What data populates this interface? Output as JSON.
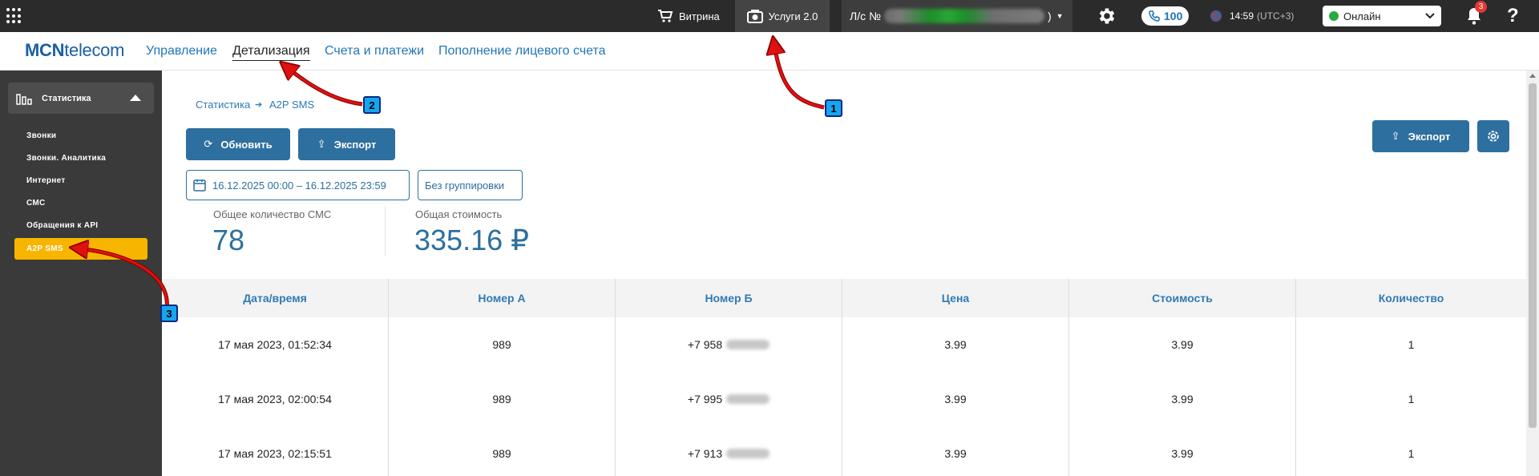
{
  "topbar": {
    "apps_icon": "grid-apps-icon",
    "showcase_label": "Витрина",
    "services_label": "Услуги 2.0",
    "account_prefix": "Л/с №",
    "account_suffix": ")",
    "phone_count": "100",
    "time": "14:59",
    "timezone": "(UTC+3)",
    "status": "Онлайн",
    "notifications_count": "3",
    "help": "?"
  },
  "nav": {
    "logo_bold": "MCN",
    "logo_rest": "telecom",
    "links": [
      "Управление",
      "Детализация",
      "Счета и платежи",
      "Пополнение лицевого счета"
    ],
    "active": "Детализация"
  },
  "sidebar": {
    "section": "Статистика",
    "items": [
      "Звонки",
      "Звонки. Аналитика",
      "Интернет",
      "СМС",
      "Обращения к API",
      "A2P SMS"
    ],
    "active": "A2P SMS"
  },
  "breadcrumb": [
    "Статистика",
    "A2P SMS"
  ],
  "toolbar": {
    "refresh": "Обновить",
    "export": "Экспорт",
    "export_right": "Экспорт",
    "date_range": "16.12.2025 00:00 – 16.12.2025 23:59",
    "grouping": "Без группировки"
  },
  "stats": {
    "count_label": "Общее количество СМС",
    "count_value": "78",
    "cost_label": "Общая стоимость",
    "cost_value": "335.16 ₽"
  },
  "table": {
    "columns": [
      "Дата/время",
      "Номер А",
      "Номер Б",
      "Цена",
      "Стоимость",
      "Количество"
    ],
    "rows": [
      [
        "17 мая 2023, 01:52:34",
        "989",
        "+7 958",
        "3.99",
        "3.99",
        "1"
      ],
      [
        "17 мая 2023, 02:00:54",
        "989",
        "+7 995",
        "3.99",
        "3.99",
        "1"
      ],
      [
        "17 мая 2023, 02:15:51",
        "989",
        "+7 913",
        "3.99",
        "3.99",
        "1"
      ]
    ]
  },
  "annotations": [
    "1",
    "2",
    "3"
  ],
  "colors": {
    "topbar": "#2b2b2b",
    "accent": "#2d6f9e",
    "link": "#2176b8",
    "sidebar": "#3a3a3a",
    "sidebar_active": "#f7b500",
    "online": "#2aa842",
    "arrow": "#e01010",
    "marker": "#18a5f0"
  }
}
